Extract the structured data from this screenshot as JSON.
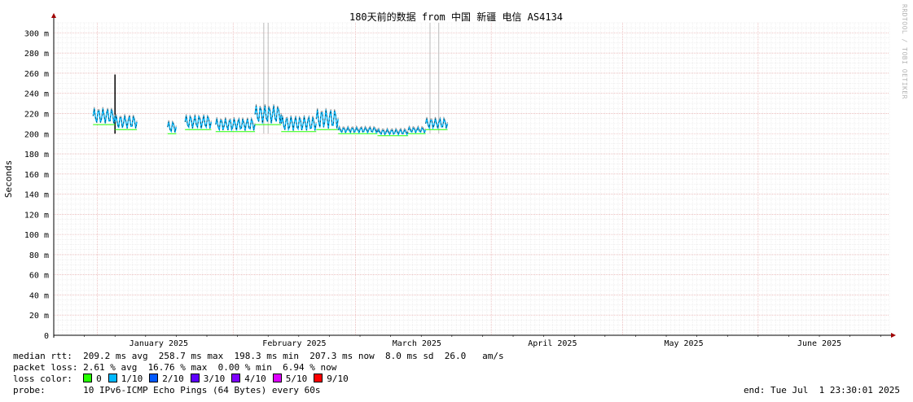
{
  "chart_data": {
    "type": "line",
    "title": "180天前的数据 from 中国 新疆 电信 AS4134",
    "ylabel": "Seconds",
    "xlabel": "",
    "ylim": [
      0,
      310
    ],
    "y_ticks": [
      "0",
      "20 m",
      "40 m",
      "60 m",
      "80 m",
      "100 m",
      "120 m",
      "140 m",
      "160 m",
      "180 m",
      "200 m",
      "220 m",
      "240 m",
      "260 m",
      "280 m",
      "300 m"
    ],
    "x_range": [
      "2024-12-22",
      "2025-07-01"
    ],
    "x_ticks": [
      {
        "label": "January 2025",
        "date": "2025-01-01"
      },
      {
        "label": "February 2025",
        "date": "2025-02-01"
      },
      {
        "label": "March 2025",
        "date": "2025-03-01"
      },
      {
        "label": "April 2025",
        "date": "2025-04-01"
      },
      {
        "label": "May 2025",
        "date": "2025-05-01"
      },
      {
        "label": "June 2025",
        "date": "2025-06-01"
      }
    ],
    "series": [
      {
        "name": "median rtt",
        "segments": [
          {
            "start": "2024-12-31",
            "end": "2025-01-05",
            "min": 210,
            "max": 225
          },
          {
            "start": "2025-01-05",
            "end": "2025-01-10",
            "min": 205,
            "max": 218
          },
          {
            "start": "2025-01-17",
            "end": "2025-01-19",
            "min": 201,
            "max": 212
          },
          {
            "start": "2025-01-21",
            "end": "2025-01-27",
            "min": 205,
            "max": 218
          },
          {
            "start": "2025-01-28",
            "end": "2025-02-06",
            "min": 203,
            "max": 215
          },
          {
            "start": "2025-02-06",
            "end": "2025-02-12",
            "min": 210,
            "max": 228
          },
          {
            "start": "2025-02-12",
            "end": "2025-02-20",
            "min": 203,
            "max": 217
          },
          {
            "start": "2025-02-20",
            "end": "2025-02-25",
            "min": 205,
            "max": 224
          },
          {
            "start": "2025-02-25",
            "end": "2025-03-06",
            "min": 201,
            "max": 206
          },
          {
            "start": "2025-03-06",
            "end": "2025-03-13",
            "min": 199,
            "max": 204
          },
          {
            "start": "2025-03-13",
            "end": "2025-03-17",
            "min": 201,
            "max": 206
          },
          {
            "start": "2025-03-17",
            "end": "2025-03-22",
            "min": 205,
            "max": 215
          }
        ]
      }
    ],
    "spikes": [
      {
        "date": "2025-01-05",
        "value": 258.7
      },
      {
        "date": "2025-02-08",
        "value": 310
      },
      {
        "date": "2025-02-09",
        "value": 310
      },
      {
        "date": "2025-03-18",
        "value": 310
      },
      {
        "date": "2025-03-20",
        "value": 310
      }
    ],
    "grid": true
  },
  "stats": {
    "median_rtt": "median rtt:  209.2 ms avg  258.7 ms max  198.3 ms min  207.3 ms now  8.0 ms sd  26.0   am/s",
    "packet_loss": "packet loss: 2.61 % avg  16.76 % max  0.00 % min  6.94 % now",
    "loss_color_label": "loss color:",
    "probe": "probe:       10 IPv6-ICMP Echo Pings (64 Bytes) every 60s",
    "end": "end: Tue Jul  1 23:30:01 2025"
  },
  "loss_colors": [
    {
      "label": "0",
      "color": "#26ff00"
    },
    {
      "label": "1/10",
      "color": "#00b8ff"
    },
    {
      "label": "2/10",
      "color": "#0059ff"
    },
    {
      "label": "3/10",
      "color": "#5e00ff"
    },
    {
      "label": "4/10",
      "color": "#7e00ff"
    },
    {
      "label": "5/10",
      "color": "#dd00ff"
    },
    {
      "label": "9/10",
      "color": "#ff0000"
    }
  ],
  "watermark": "RRDTOOL / TOBI OETIKER"
}
